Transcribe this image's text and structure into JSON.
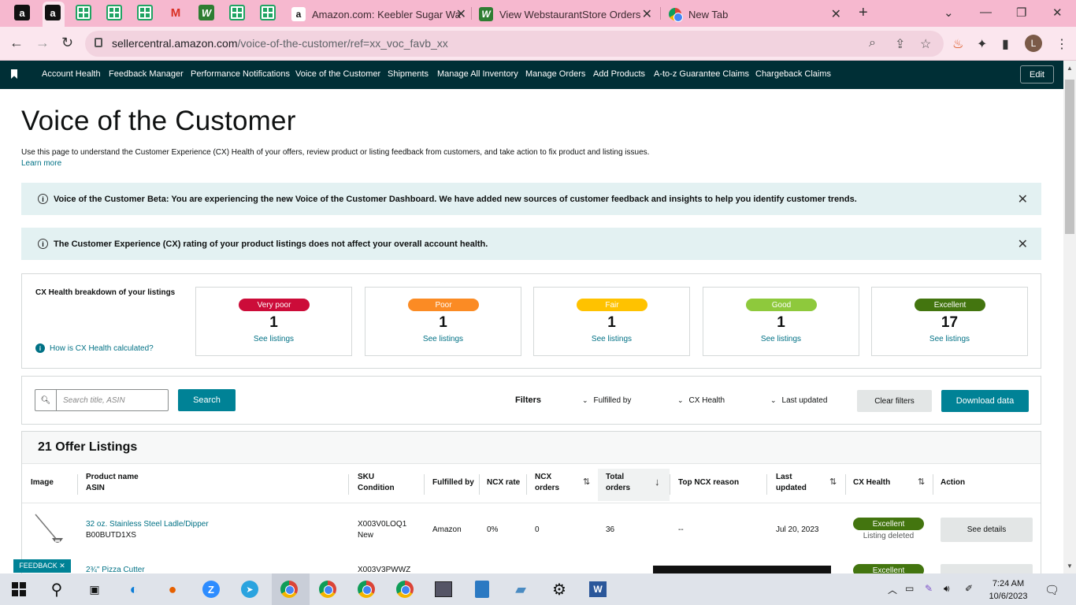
{
  "browser": {
    "tabs": [
      {
        "title": "Amazon.com: Keebler Sugar Wa"
      },
      {
        "title": "View WebstaurantStore Orders"
      },
      {
        "title": "New Tab"
      }
    ],
    "url_domain": "sellercentral.amazon.com",
    "url_path": "/voice-of-the-customer/ref=xx_voc_favb_xx",
    "profile_initial": "L"
  },
  "nav": {
    "items": [
      "Account Health",
      "Feedback Manager",
      "Performance Notifications",
      "Voice of the Customer",
      "Shipments",
      "Manage All Inventory",
      "Manage Orders",
      "Add Products",
      "A-to-z Guarantee Claims",
      "Chargeback Claims"
    ],
    "edit_label": "Edit"
  },
  "page": {
    "title": "Voice of the Customer",
    "description": "Use this page to understand the Customer Experience (CX) Health of your offers, review product or listing feedback from customers, and take action to fix product and listing issues.",
    "learn_more": "Learn more"
  },
  "alerts": [
    {
      "text": "Voice of the Customer Beta: You are experiencing the new Voice of the Customer Dashboard. We have added new sources of customer feedback and insights to help you identify customer trends."
    },
    {
      "text": "The Customer Experience (CX) rating of your product listings does not affect your overall account health."
    }
  ],
  "cx_health": {
    "label": "CX Health breakdown of your listings",
    "how_link": "How is CX Health calculated?",
    "cards": [
      {
        "rating": "Very poor",
        "count": "1",
        "link": "See listings",
        "color": "#cc0c39"
      },
      {
        "rating": "Poor",
        "count": "1",
        "link": "See listings",
        "color": "#fb8b24"
      },
      {
        "rating": "Fair",
        "count": "1",
        "link": "See listings",
        "color": "#ffc200"
      },
      {
        "rating": "Good",
        "count": "1",
        "link": "See listings",
        "color": "#8ec93c"
      },
      {
        "rating": "Excellent",
        "count": "17",
        "link": "See listings",
        "color": "#43750f"
      }
    ]
  },
  "filters": {
    "search_placeholder": "Search title, ASIN",
    "search_button": "Search",
    "filters_label": "Filters",
    "dropdowns": [
      "Fulfilled by",
      "CX Health",
      "Last updated"
    ],
    "clear_button": "Clear filters",
    "download_button": "Download data"
  },
  "listings": {
    "title": "21 Offer Listings",
    "columns": {
      "image": "Image",
      "product_name": "Product name",
      "asin": "ASIN",
      "sku": "SKU",
      "condition": "Condition",
      "fulfilled_by": "Fulfilled by",
      "ncx_rate": "NCX rate",
      "ncx_orders_1": "NCX",
      "ncx_orders_2": "orders",
      "total_orders_1": "Total",
      "total_orders_2": "orders",
      "top_reason": "Top NCX reason",
      "last_updated_1": "Last",
      "last_updated_2": "updated",
      "cx_health": "CX Health",
      "action": "Action"
    },
    "rows": [
      {
        "name": "32 oz. Stainless Steel Ladle/Dipper",
        "asin": "B00BUTD1XS",
        "sku": "X003V0LOQ1",
        "condition": "New",
        "fulfilled_by": "Amazon",
        "ncx_rate": "0%",
        "ncx_orders": "0",
        "total_orders": "36",
        "top_reason": "--",
        "last_updated": "Jul 20, 2023",
        "health": "Excellent",
        "health_note": "Listing deleted",
        "action": "See details"
      },
      {
        "name": "2¾\" Pizza Cutter",
        "sku": "X003V3PWWZ",
        "health": "Excellent"
      }
    ]
  },
  "feedback_tab": "FEEDBACK ✕",
  "taskbar": {
    "time": "7:24 AM",
    "date": "10/6/2023"
  }
}
